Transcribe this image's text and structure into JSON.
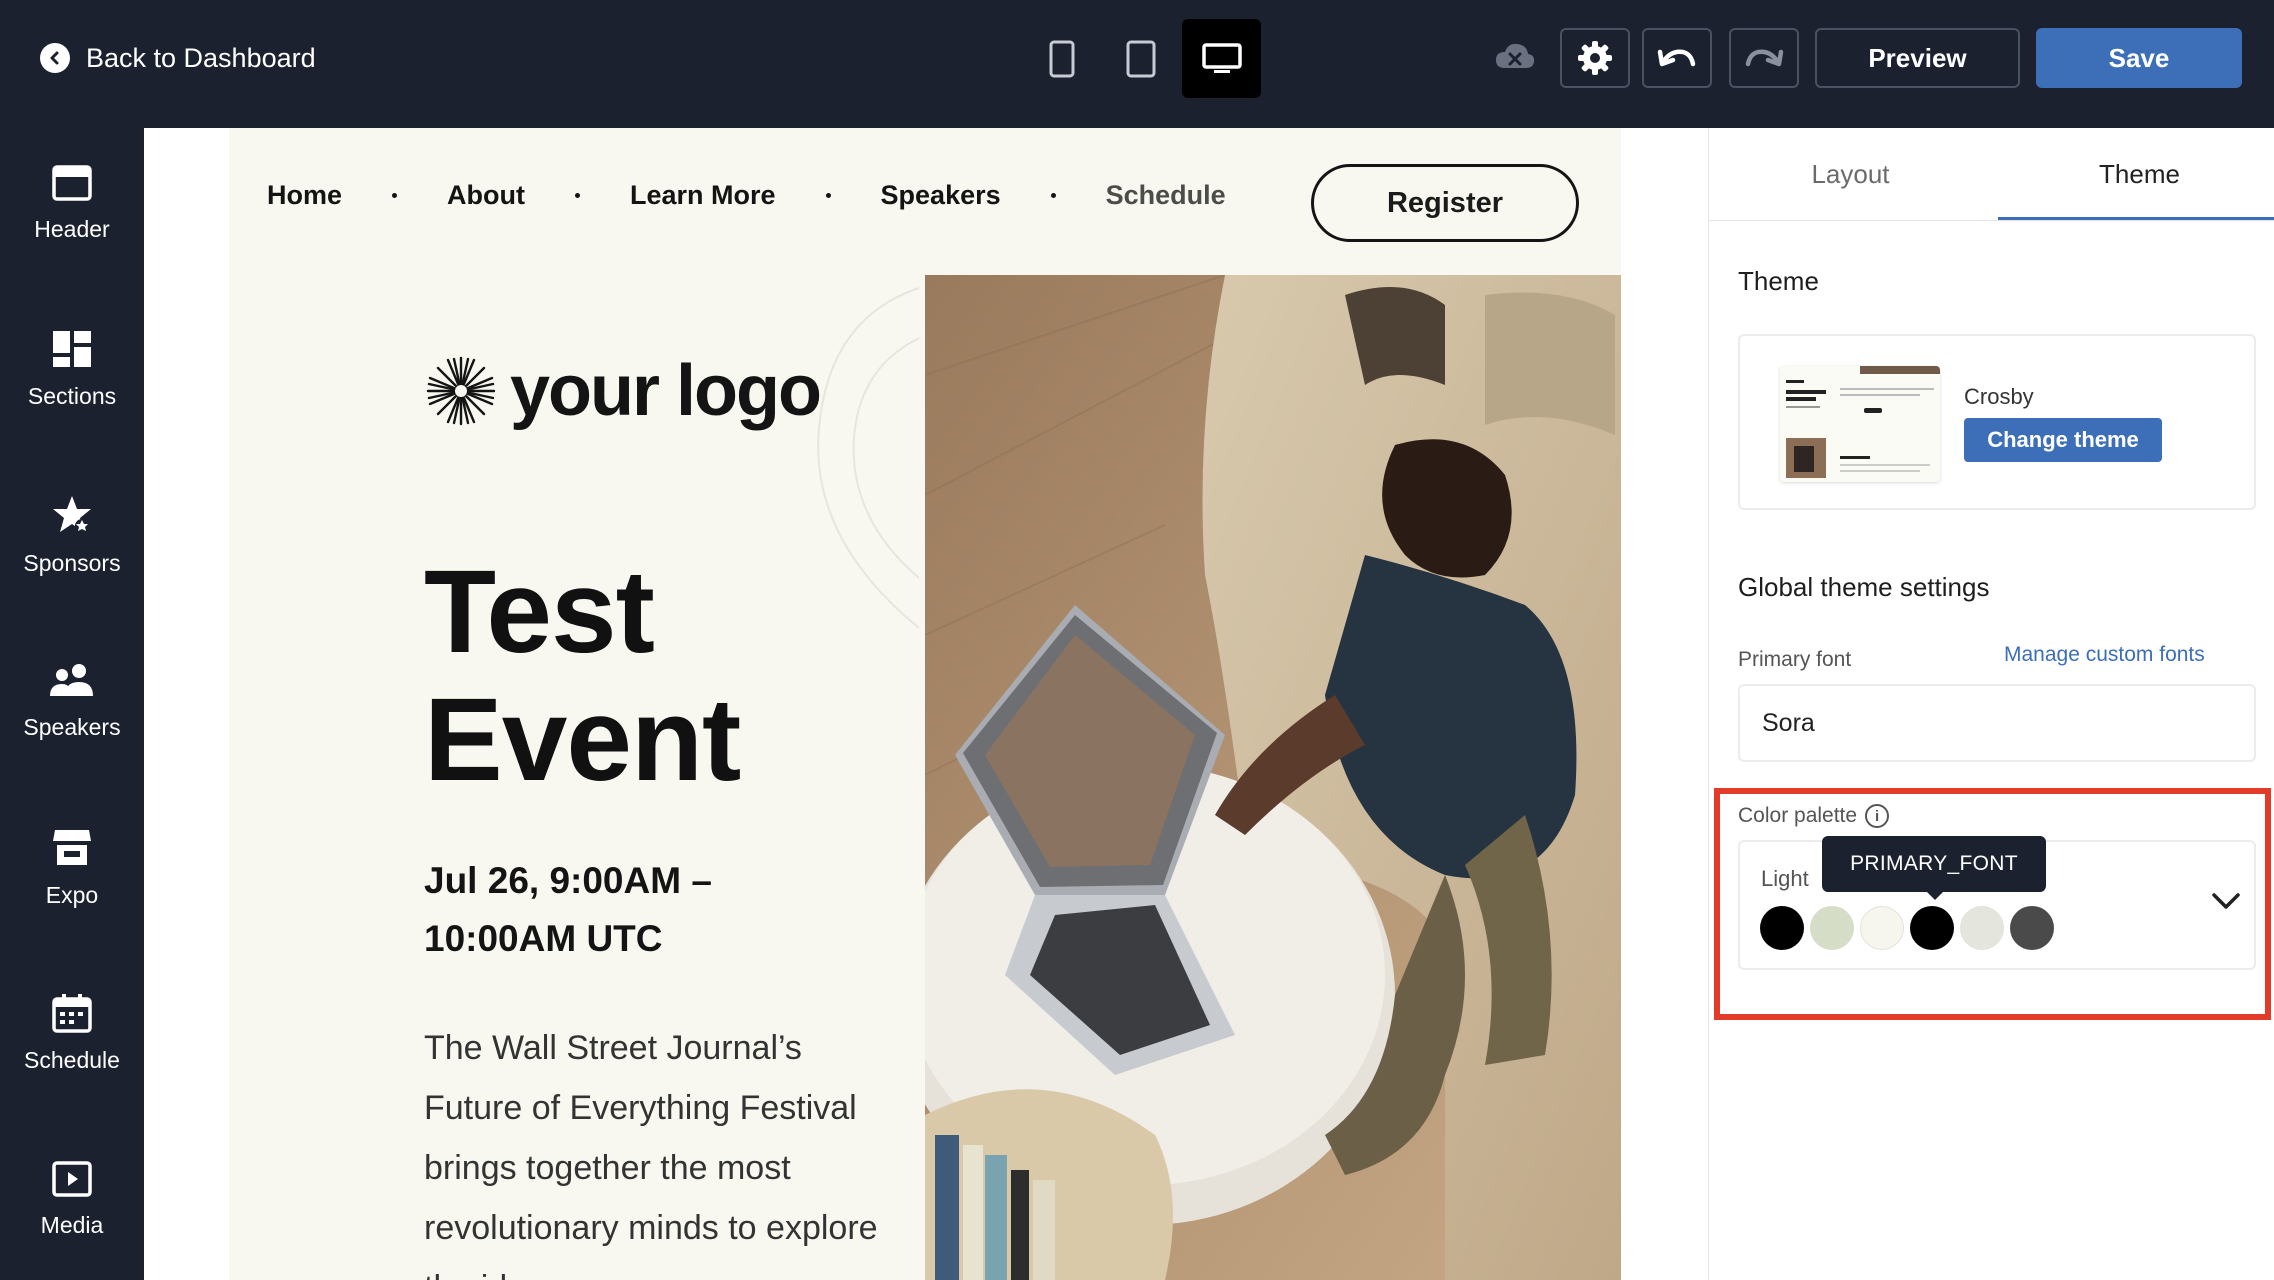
{
  "topbar": {
    "back_label": "Back to Dashboard",
    "preview_label": "Preview",
    "save_label": "Save",
    "device_active": "desktop",
    "icons": [
      "back-arrow-icon",
      "phone-icon",
      "tablet-icon",
      "desktop-icon",
      "cloud-offline-icon",
      "gear-icon",
      "undo-icon",
      "redo-icon"
    ]
  },
  "sidebar": {
    "items": [
      {
        "label": "Header",
        "icon": "header-icon"
      },
      {
        "label": "Sections",
        "icon": "sections-icon"
      },
      {
        "label": "Sponsors",
        "icon": "sponsors-star-icon"
      },
      {
        "label": "Speakers",
        "icon": "speakers-people-icon"
      },
      {
        "label": "Expo",
        "icon": "expo-booth-icon"
      },
      {
        "label": "Schedule",
        "icon": "calendar-icon"
      },
      {
        "label": "Media",
        "icon": "media-play-icon"
      }
    ]
  },
  "page": {
    "nav": [
      "Home",
      "About",
      "Learn More",
      "Speakers",
      "Schedule"
    ],
    "register_label": "Register",
    "logo_text": "your logo",
    "title_line1": "Test",
    "title_line2": "Event",
    "date_line1": "Jul 26, 9:00AM –",
    "date_line2": "10:00AM UTC",
    "description": "The Wall Street Journal’s Future of Everything Festival brings together the most revolutionary minds to explore the ideas"
  },
  "panel": {
    "tabs": [
      "Layout",
      "Theme"
    ],
    "active_tab": "Theme",
    "theme_heading": "Theme",
    "theme_name": "Crosby",
    "change_theme_label": "Change theme",
    "global_heading": "Global theme settings",
    "primary_font_label": "Primary font",
    "manage_fonts_label": "Manage custom fonts",
    "primary_font_value": "Sora",
    "palette_label": "Color palette",
    "palette_mode": "Light",
    "palette_swatches": [
      "#000000",
      "#d6ddc6",
      "#f6f6ee",
      "#000000",
      "#e4e5dc",
      "#4a4a4a"
    ],
    "tooltip": "PRIMARY_FONT"
  },
  "colors": {
    "topbar_bg": "#1c2130",
    "accent": "#3d6fb8",
    "highlight": "#e33b2a",
    "page_bg": "#f8f8f1"
  }
}
